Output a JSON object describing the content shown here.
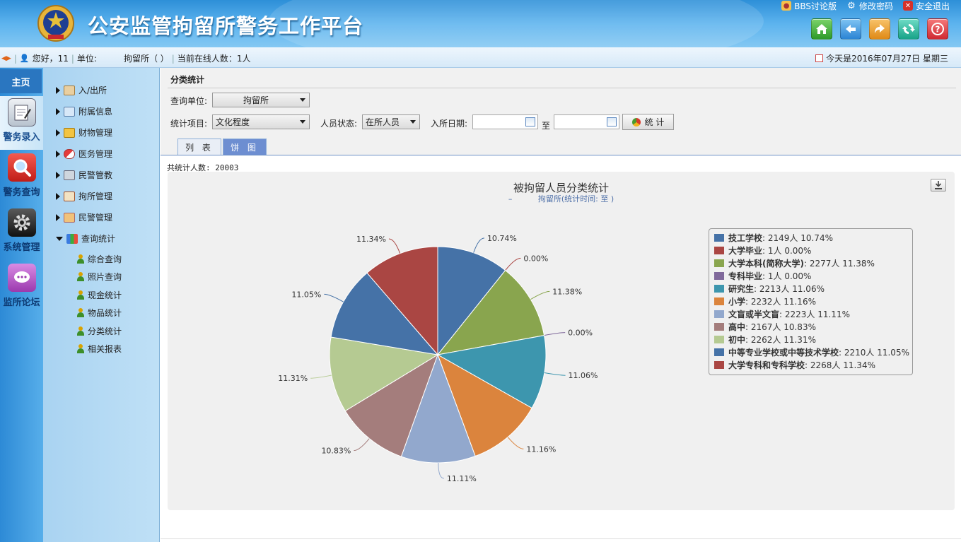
{
  "header": {
    "title": "公安监管拘留所警务工作平台",
    "links": {
      "bbs": "BBS讨论版",
      "change_password": "修改密码",
      "logout": "安全退出"
    }
  },
  "infobar": {
    "greeting": "您好，11",
    "unit_label": "单位:",
    "unit_value": "拘留所（          ）",
    "online": "当前在线人数：1人",
    "date": "今天是2016年07月27日 星期三"
  },
  "leftnav": {
    "home": "主页",
    "modules": [
      "警务录入",
      "警务查询",
      "系统管理",
      "监所论坛"
    ]
  },
  "submenu": {
    "items": [
      "入/出所",
      "附属信息",
      "财物管理",
      "医务管理",
      "民警管教",
      "拘所管理",
      "民警管理",
      "查询统计"
    ],
    "subitems": [
      "综合查询",
      "照片查询",
      "现金统计",
      "物品统计",
      "分类统计",
      "相关报表"
    ]
  },
  "main": {
    "section_title": "分类统计",
    "query_unit_label": "查询单位:",
    "query_unit_value": "拘留所",
    "stat_item_label": "统计项目:",
    "stat_item_value": "文化程度",
    "person_status_label": "人员状态:",
    "person_status_value": "在所人员",
    "entry_date_label": "入所日期:",
    "to_label": "至",
    "stat_button": "统 计",
    "tabs": [
      "列 表",
      "饼 图"
    ],
    "total": "共统计人数: 20003"
  },
  "colors": {
    "header": "#3d9be2",
    "active_tab": "#6d8ed1"
  },
  "chart_data": {
    "type": "pie",
    "title": "被拘留人员分类统计",
    "subtitle": "拘留所(统计时间: 至 )",
    "subtitle_prefix": "–",
    "legend_position": "right",
    "series": [
      {
        "name": "技工学校",
        "value": 2149,
        "pct": "10.74%",
        "color": "#4572a7"
      },
      {
        "name": "大学毕业",
        "value": 1,
        "pct": "0.00%",
        "color": "#aa4643"
      },
      {
        "name": "大学本科(简称大学)",
        "value": 2277,
        "pct": "11.38%",
        "color": "#89a54e"
      },
      {
        "name": "专科毕业",
        "value": 1,
        "pct": "0.00%",
        "color": "#80699b"
      },
      {
        "name": "研究生",
        "value": 2213,
        "pct": "11.06%",
        "color": "#3d96ae"
      },
      {
        "name": "小学",
        "value": 2232,
        "pct": "11.16%",
        "color": "#db843d"
      },
      {
        "name": "文盲或半文盲",
        "value": 2223,
        "pct": "11.11%",
        "color": "#92a8cd"
      },
      {
        "name": "高中",
        "value": 2167,
        "pct": "10.83%",
        "color": "#a47d7c"
      },
      {
        "name": "初中",
        "value": 2262,
        "pct": "11.31%",
        "color": "#b5ca92"
      },
      {
        "name": "中等专业学校或中等技术学校",
        "value": 2210,
        "pct": "11.05%",
        "color": "#4572a7"
      },
      {
        "name": "大学专科和专科学校",
        "value": 2268,
        "pct": "11.34%",
        "color": "#aa4643"
      }
    ],
    "legend_unit": "人"
  }
}
